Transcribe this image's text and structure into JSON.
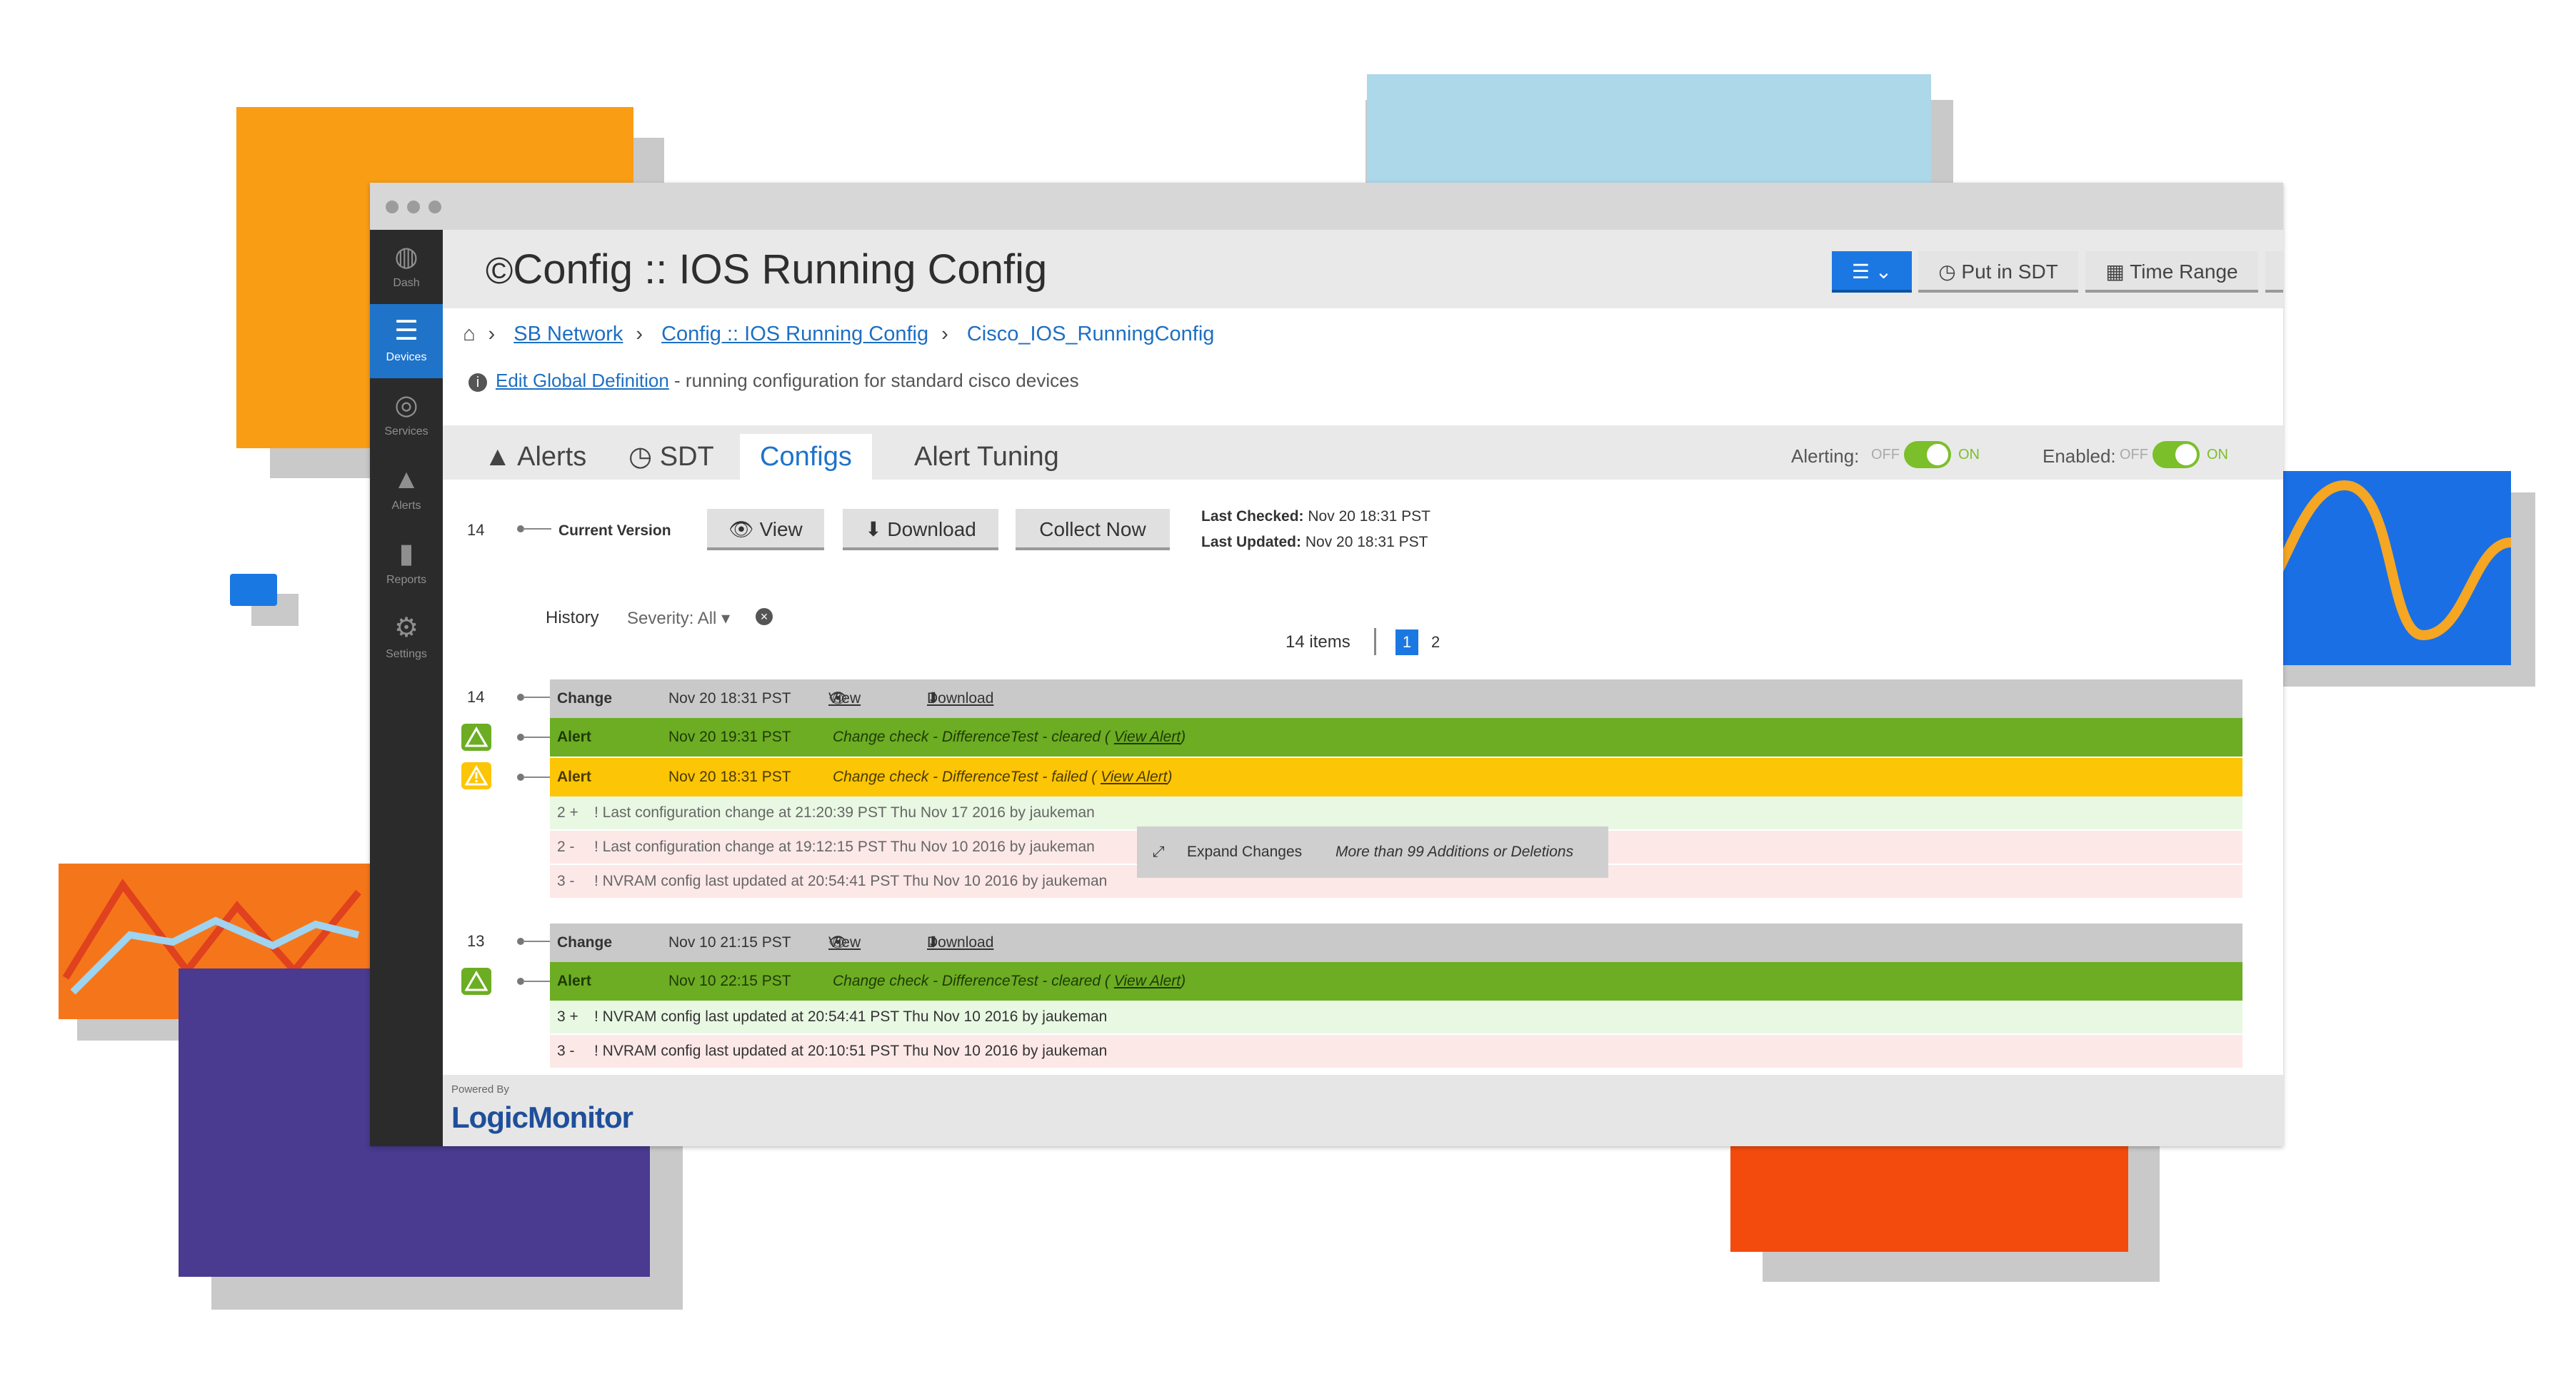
{
  "brand": {
    "accent": "#1f73c9",
    "alert_green": "#6cad23",
    "alert_yellow": "#fcc505"
  },
  "sidebar": {
    "items": [
      {
        "label": "Dash",
        "icon": "dashboard-icon"
      },
      {
        "label": "Devices",
        "icon": "devices-icon",
        "active": true
      },
      {
        "label": "Services",
        "icon": "services-icon"
      },
      {
        "label": "Alerts",
        "icon": "alerts-icon"
      },
      {
        "label": "Reports",
        "icon": "reports-icon"
      },
      {
        "label": "Settings",
        "icon": "settings-icon"
      }
    ]
  },
  "header": {
    "title": "Config :: IOS Running Config",
    "put_in_sdt": "Put in SDT",
    "time_range": "Time Range"
  },
  "breadcrumb": {
    "items": [
      "SB Network",
      "Config :: IOS Running Config",
      "Cisco_IOS_RunningConfig"
    ]
  },
  "info": {
    "link": "Edit Global Definition",
    "text": " - running configuration for standard cisco devices"
  },
  "tabs": [
    "Alerts",
    "SDT",
    "Configs",
    "Alert Tuning"
  ],
  "toggles": {
    "alerting_label": "Alerting:",
    "enabled_label": "Enabled:",
    "off": "OFF",
    "on": "ON"
  },
  "current": {
    "number": "14",
    "label": "Current Version",
    "view": "View",
    "download": "Download",
    "collect_now": "Collect Now",
    "last_checked_label": "Last Checked:",
    "last_checked": "Nov 20 18:31 PST",
    "last_updated_label": "Last Updated:",
    "last_updated": "Nov 20 18:31 PST"
  },
  "history": {
    "label": "History",
    "severity": "Severity: All",
    "items_count": "14 items",
    "pages": [
      "1",
      "2"
    ]
  },
  "versions": [
    {
      "number": "14",
      "change": {
        "type": "Change",
        "time": "Nov 20 18:31 PST",
        "view": "View",
        "download": "Download"
      },
      "alerts": [
        {
          "type": "Alert",
          "time": "Nov 20 19:31 PST",
          "message": "Change check - DifferenceTest - cleared",
          "link": "View Alert",
          "level": "cleared"
        },
        {
          "type": "Alert",
          "time": "Nov 20 18:31 PST",
          "message": "Change check - DifferenceTest - failed",
          "link": "View Alert",
          "level": "warning"
        }
      ],
      "diff": [
        {
          "kind": "add",
          "line": "2 +",
          "text": "! Last configuration change at 21:20:39 PST Thu Nov 17 2016 by jaukeman"
        },
        {
          "kind": "del",
          "line": "2 -",
          "text": "! Last configuration change at 19:12:15 PST Thu Nov 10 2016 by jaukeman"
        },
        {
          "kind": "del",
          "line": "3 -",
          "text": "! NVRAM config last updated at 20:54:41 PST Thu Nov 10 2016 by jaukeman"
        }
      ],
      "expand": {
        "label": "Expand Changes",
        "note": "More than 99 Additions or Deletions"
      }
    },
    {
      "number": "13",
      "change": {
        "type": "Change",
        "time": "Nov 10 21:15 PST",
        "view": "View",
        "download": "Download"
      },
      "alerts": [
        {
          "type": "Alert",
          "time": "Nov 10 22:15 PST",
          "message": "Change check - DifferenceTest - cleared",
          "link": "View Alert",
          "level": "cleared"
        }
      ],
      "diff": [
        {
          "kind": "add",
          "line": "3 +",
          "text": "! NVRAM config last updated at 20:54:41 PST Thu Nov 10 2016 by jaukeman"
        },
        {
          "kind": "del",
          "line": "3 -",
          "text": "! NVRAM config last updated at 20:10:51 PST Thu Nov 10 2016 by jaukeman"
        }
      ]
    }
  ],
  "footer": {
    "powered_by": "Powered By",
    "logo": "LogicMonitor"
  }
}
